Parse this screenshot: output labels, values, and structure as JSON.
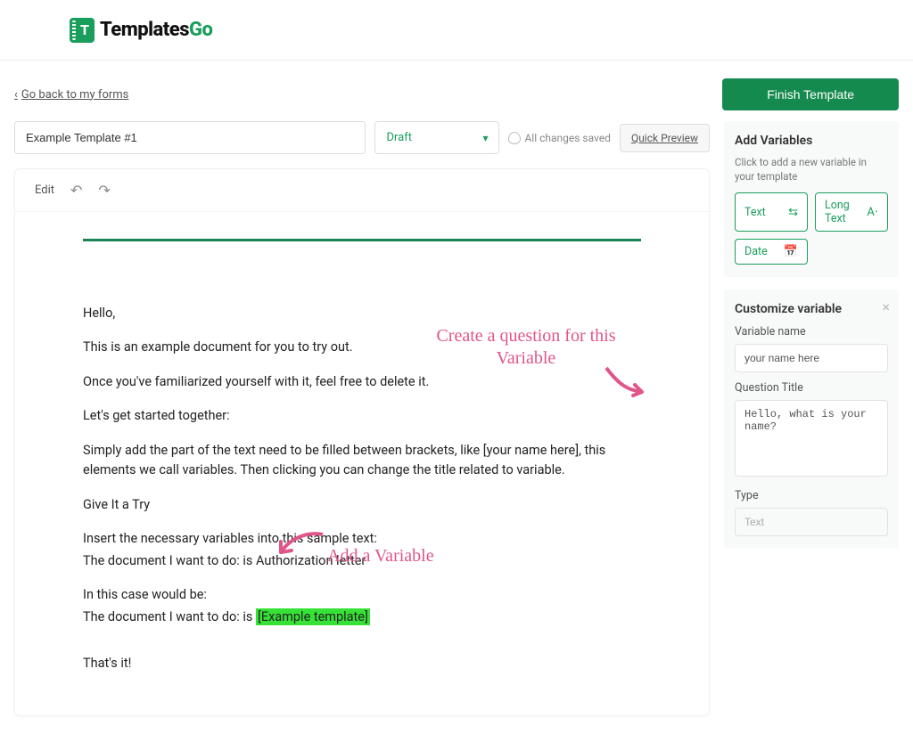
{
  "header": {
    "logo_main": "Templates",
    "logo_accent": "Go"
  },
  "actions": {
    "back_link": "Go back to my forms",
    "finish_button": "Finish Template"
  },
  "meta": {
    "title_value": "Example Template #1",
    "status_value": "Draft",
    "saved_status": "All changes saved",
    "quick_preview": "Quick Preview"
  },
  "toolbar": {
    "edit_label": "Edit"
  },
  "document": {
    "p1": "Hello,",
    "p2": "This is an example document for you to try out.",
    "p3": "Once you've familiarized yourself with it, feel free to delete it.",
    "p4": "Let's get started together:",
    "p5": "Simply add the part of the text need to be filled between brackets, like [your name here], this elements we call variables.  Then clicking you can change the title related to variable.",
    "p6": "Give It a Try",
    "p7": "Insert the necessary variables into this sample text:",
    "p8": "The document I want to do: is Authorization letter",
    "p9": "In this case would be:",
    "p10a": "The document I want to do: is ",
    "p10_highlight": "[Example template] ",
    "p11": "That's it!"
  },
  "sidebar": {
    "add_variables": {
      "title": "Add Variables",
      "hint": "Click to add a new variable in your template",
      "chips": {
        "text": "Text",
        "long_text": "Long Text",
        "date": "Date"
      }
    },
    "customize": {
      "title": "Customize variable",
      "var_name_label": "Variable name",
      "var_name_value": "your name here",
      "question_label": "Question Title",
      "question_value": "Hello, what is your name?",
      "type_label": "Type",
      "type_value": "Text"
    }
  },
  "annotations": {
    "a1": "Create a question for this Variable",
    "a2": "Add a  Variable"
  }
}
